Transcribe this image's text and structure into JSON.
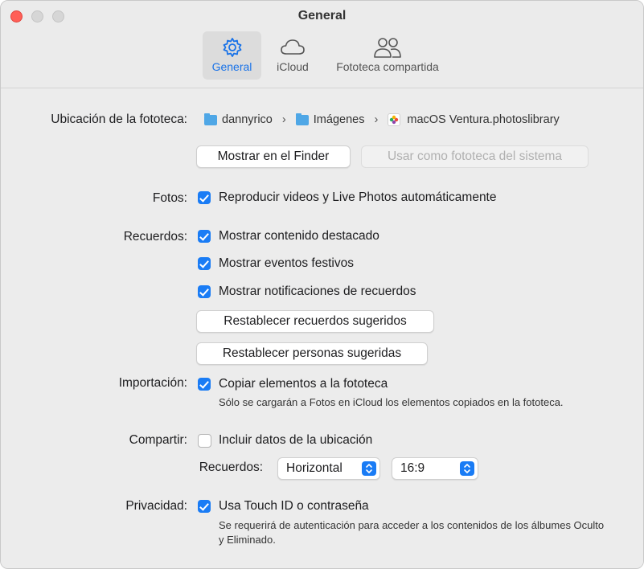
{
  "window": {
    "title": "General"
  },
  "toolbar": {
    "tabs": [
      {
        "label": "General",
        "icon": "gear-icon",
        "selected": true
      },
      {
        "label": "iCloud",
        "icon": "cloud-icon",
        "selected": false
      },
      {
        "label": "Fototeca compartida",
        "icon": "people-icon",
        "selected": false
      }
    ]
  },
  "library": {
    "label": "Ubicación de la fototeca:",
    "path": [
      "dannyrico",
      "Imágenes",
      "macOS Ventura.photoslibrary"
    ],
    "show_in_finder": "Mostrar en el Finder",
    "use_as_system": "Usar como fototeca del sistema"
  },
  "photos": {
    "label": "Fotos:",
    "autoplay": {
      "label": "Reproducir videos y Live Photos automáticamente",
      "checked": true
    }
  },
  "memories": {
    "label": "Recuerdos:",
    "featured": {
      "label": "Mostrar contenido destacado",
      "checked": true
    },
    "holidays": {
      "label": "Mostrar eventos festivos",
      "checked": true
    },
    "notifications": {
      "label": "Mostrar notificaciones de recuerdos",
      "checked": true
    },
    "reset_memories": "Restablecer recuerdos sugeridos",
    "reset_people": "Restablecer personas sugeridas"
  },
  "import": {
    "label": "Importación:",
    "copy": {
      "label": "Copiar elementos a la fototeca",
      "checked": true
    },
    "note": "Sólo se cargarán a Fotos en iCloud los elementos copiados en la fototeca."
  },
  "sharing": {
    "label": "Compartir:",
    "location": {
      "label": "Incluir datos de la ubicación",
      "checked": false
    },
    "memories_label": "Recuerdos:",
    "orientation": "Horizontal",
    "aspect": "16:9"
  },
  "privacy": {
    "label": "Privacidad:",
    "touchid": {
      "label": "Usa Touch ID o contraseña",
      "checked": true
    },
    "note": "Se requerirá de autenticación para acceder a los contenidos de los álbumes Oculto y Eliminado."
  },
  "colors": {
    "accent": "#1a7cf5",
    "close": "#ff5f57"
  }
}
